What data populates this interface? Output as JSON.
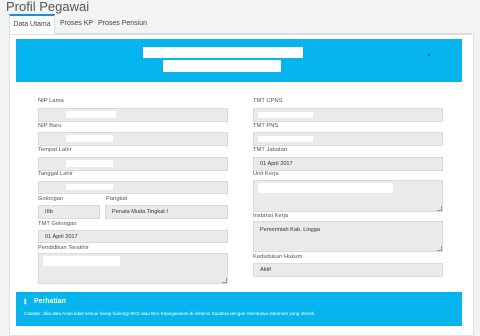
{
  "page": {
    "title": "Profil Pegawai"
  },
  "tabs": [
    {
      "label": "Data Utama",
      "active": true
    },
    {
      "label": "Proses KP",
      "active": false
    },
    {
      "label": "Proses Pensiun",
      "active": false
    }
  ],
  "form": {
    "nip_lama": {
      "label": "NIP Lama",
      "value": ""
    },
    "nip_baru": {
      "label": "NIP Baru",
      "value": ""
    },
    "tempat_lahir": {
      "label": "Tempat Lahir",
      "value": ""
    },
    "tanggal_lahir": {
      "label": "Tanggal Lahir",
      "value": ""
    },
    "golongan": {
      "label": "Golongan",
      "value": "IIIb"
    },
    "pangkat": {
      "label": "Pangkat",
      "value": "Penata Muda Tingkat I"
    },
    "tmt_golongan": {
      "label": "TMT Golongan",
      "value": "01 April 2017"
    },
    "pendidikan_terakhir": {
      "label": "Pendidikan Terakhir",
      "value": ""
    },
    "tmt_cpns": {
      "label": "TMT CPNS",
      "value": ""
    },
    "tmt_pns": {
      "label": "TMT PNS",
      "value": ""
    },
    "tmt_jabatan": {
      "label": "TMT Jabatan",
      "value": "01 April 2017"
    },
    "unit_kerja": {
      "label": "Unit Kerja",
      "value": ""
    },
    "instansi_kerja": {
      "label": "Instansi Kerja",
      "value": "Pemerintah Kab. Lingga"
    },
    "kedudukan_hukum": {
      "label": "Kedudukan Hukum",
      "value": "Aktif"
    }
  },
  "notice": {
    "icon": "info-icon",
    "title": "Perhatian",
    "text": "Catatan: Jika data Anda tidak sesuai harap hubungi BKD atau Biro Kepegawaian di instansi Saudara dengan membawa dokumen yang otentik."
  },
  "colors": {
    "accent": "#06b4ee",
    "tab_active": "#1a90d3",
    "field_bg": "#e9eaeb"
  }
}
